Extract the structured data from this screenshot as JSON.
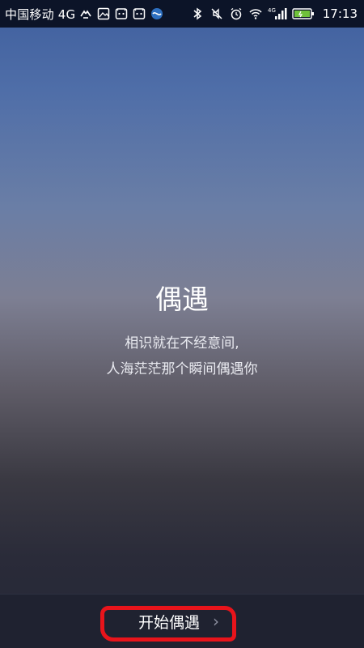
{
  "status_bar": {
    "carrier": "中国移动 4G",
    "net_label": "4G",
    "time": "17:13",
    "icons": [
      "signal-arrows-icon",
      "image-icon",
      "android-icon",
      "android-icon",
      "china-mobile-icon",
      "bluetooth-icon",
      "mute-icon",
      "alarm-icon",
      "wifi-icon",
      "cell-signal-icon",
      "battery-icon"
    ]
  },
  "main": {
    "title": "偶遇",
    "subtitle_line1": "相识就在不经意间,",
    "subtitle_line2": "人海茫茫那个瞬间偶遇你"
  },
  "bottom": {
    "start_label": "开始偶遇",
    "chevron_icon": "chevron-right-icon"
  },
  "colors": {
    "annotation": "#e8141b",
    "statusbar_bg": "#0c1428",
    "bottombar_bg": "#1f2230"
  }
}
